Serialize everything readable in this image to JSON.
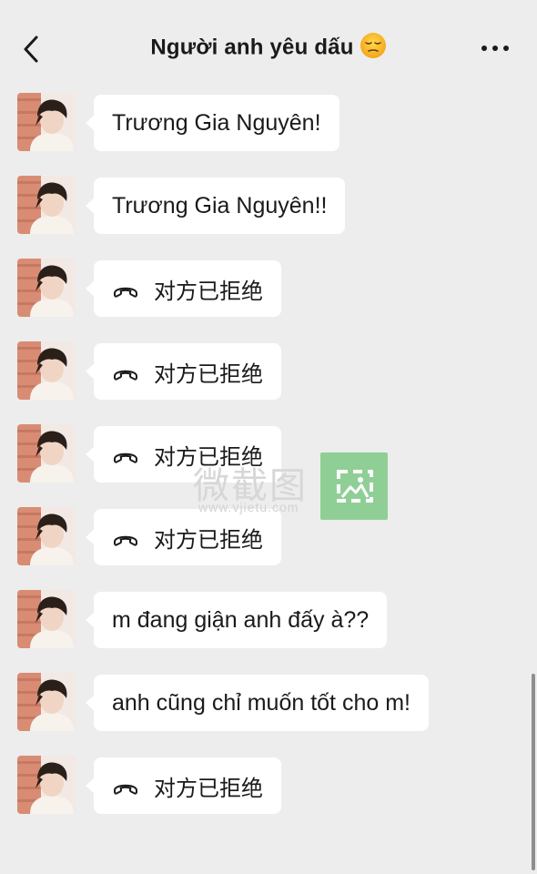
{
  "header": {
    "back_icon": "chevron-left-icon",
    "title": "Người anh yêu dấu",
    "title_emoji": "unamused-face",
    "more_icon": "ellipsis-icon"
  },
  "messages": [
    {
      "type": "text",
      "text": "Trương Gia Nguyên!"
    },
    {
      "type": "text",
      "text": "Trương Gia Nguyên!!"
    },
    {
      "type": "call",
      "icon": "phone-hangup-icon",
      "text": "对方已拒绝"
    },
    {
      "type": "call",
      "icon": "phone-hangup-icon",
      "text": "对方已拒绝"
    },
    {
      "type": "call",
      "icon": "phone-hangup-icon",
      "text": "对方已拒绝"
    },
    {
      "type": "call",
      "icon": "phone-hangup-icon",
      "text": "对方已拒绝"
    },
    {
      "type": "text",
      "text": "m đang giận anh đấy à??"
    },
    {
      "type": "text",
      "text": "anh cũng chỉ muốn tốt cho m!"
    },
    {
      "type": "call",
      "icon": "phone-hangup-icon",
      "text": "对方已拒绝"
    }
  ],
  "watermark": {
    "text": "微截图",
    "url": "www.vjietu.com",
    "color": "#8fcf96"
  },
  "colors": {
    "background": "#ededed",
    "bubble": "#ffffff",
    "text": "#1a1a1a"
  }
}
